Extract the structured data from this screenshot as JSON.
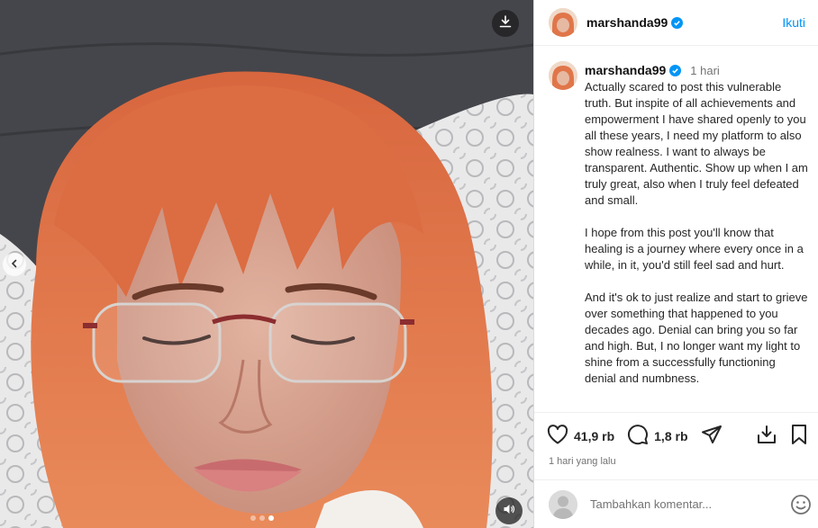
{
  "post": {
    "username": "marshanda99",
    "follow_label": "Ikuti",
    "caption_time": "1 hari",
    "caption": [
      "Actually scared to post this vulnerable truth. But inspite of all achievements and empowerment I have shared openly to you all these years, I need my platform to also show realness. I want to always be transparent. Authentic. Show up when I am truly great, also when I truly feel defeated and small.",
      "I hope from this post you'll know that healing is a journey where every once in a while, in it, you'd still feel sad and hurt.",
      "And it's ok to just realize and start to grieve over something that happened to you decades ago. Denial can bring you so far and high. But, I no longer want my light to shine from a successfully functioning denial and numbness."
    ],
    "likes": "41,9 rb",
    "comments_count": "1,8 rb",
    "time_ago": "1 hari yang lalu"
  },
  "comment_box": {
    "placeholder": "Tambahkan komentar..."
  },
  "carousel": {
    "count": 3,
    "active": 2
  },
  "icons": {
    "download": "download-icon",
    "volume": "volume-icon",
    "prev": "chevron-left-icon",
    "verified": "verified-badge-icon",
    "like": "heart-icon",
    "comment": "comment-icon",
    "share": "send-icon",
    "save": "bookmark-icon",
    "emoji": "emoji-icon"
  },
  "colors": {
    "accent": "#0095f6",
    "verified": "#0095f6",
    "hair": "#e0764a"
  }
}
